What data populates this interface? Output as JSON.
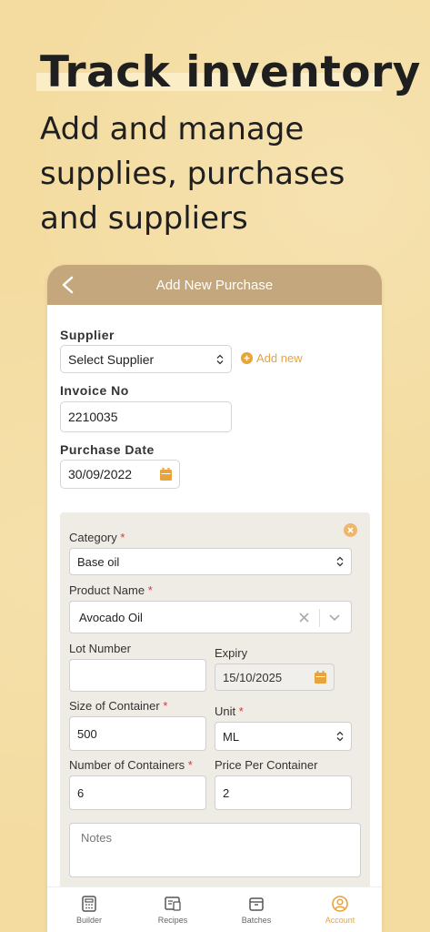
{
  "hero": {
    "headline": "Track inventory",
    "subline": "Add and manage supplies, purchases and suppliers"
  },
  "nav": {
    "title": "Add New Purchase"
  },
  "form": {
    "supplier_label": "Supplier",
    "supplier_value": "Select Supplier",
    "add_new_label": "Add new",
    "invoice_label": "Invoice No",
    "invoice_value": "2210035",
    "purchase_date_label": "Purchase Date",
    "purchase_date_value": "30/09/2022"
  },
  "item": {
    "category_label": "Category",
    "category_value": "Base oil",
    "product_label": "Product Name",
    "product_value": "Avocado Oil",
    "lot_label": "Lot Number",
    "lot_value": "",
    "expiry_label": "Expiry",
    "expiry_value": "15/10/2025",
    "size_label": "Size of Container",
    "size_value": "500",
    "unit_label": "Unit",
    "unit_value": "ML",
    "num_label": "Number of Containers",
    "num_value": "6",
    "price_label": "Price Per Container",
    "price_value": "2",
    "notes_placeholder": "Notes",
    "required_mark": "*"
  },
  "tabbar": {
    "tabs": [
      {
        "label": "Builder",
        "icon": "calculator-icon"
      },
      {
        "label": "Recipes",
        "icon": "recipes-icon"
      },
      {
        "label": "Batches",
        "icon": "box-icon"
      },
      {
        "label": "Account",
        "icon": "account-icon"
      }
    ],
    "active": "Account"
  },
  "colors": {
    "background": "#f4dca0",
    "nav": "#c4a77c",
    "accent": "#e8a33a",
    "required": "#d9363e"
  }
}
